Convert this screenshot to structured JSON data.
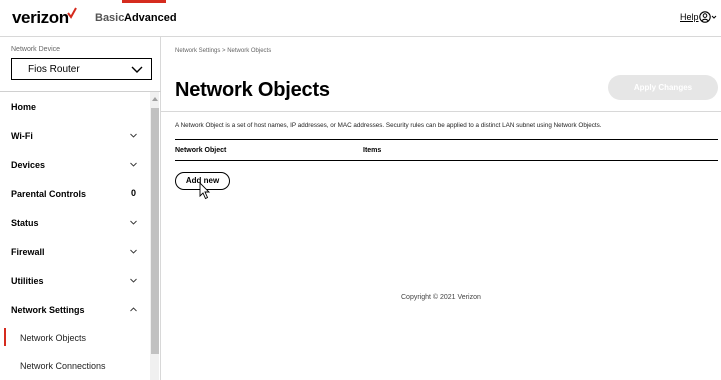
{
  "header": {
    "logo": "verizon",
    "tabs": [
      {
        "label": "Basic",
        "active": false
      },
      {
        "label": "Advanced",
        "active": true
      }
    ],
    "help": "Help",
    "accent_color": "#d52b1e"
  },
  "sidebar": {
    "device_label": "Network Device",
    "device_value": "Fios Router",
    "menu": [
      {
        "label": "Home"
      },
      {
        "label": "Wi-Fi",
        "icon": "chevron-down-icon"
      },
      {
        "label": "Devices",
        "icon": "chevron-down-icon"
      },
      {
        "label": "Parental Controls",
        "count": "0"
      },
      {
        "label": "Status",
        "icon": "chevron-down-icon"
      },
      {
        "label": "Firewall",
        "icon": "chevron-down-icon"
      },
      {
        "label": "Utilities",
        "icon": "chevron-down-icon"
      },
      {
        "label": "Network Settings",
        "icon": "chevron-up-icon"
      }
    ],
    "submenu": [
      {
        "label": "Network Objects",
        "active": true
      },
      {
        "label": "Network Connections",
        "active": false
      }
    ]
  },
  "main": {
    "breadcrumb": "Network Settings  >  Network Objects",
    "title": "Network Objects",
    "apply_button": "Apply Changes",
    "description": "A Network Object is a set of host names, IP addresses, or MAC addresses. Security rules can be applied to a distinct LAN subnet using Network Objects.",
    "table_headers": [
      "Network Object",
      "Items"
    ],
    "add_button": "Add new",
    "copyright": "Copyright © 2021 Verizon"
  }
}
